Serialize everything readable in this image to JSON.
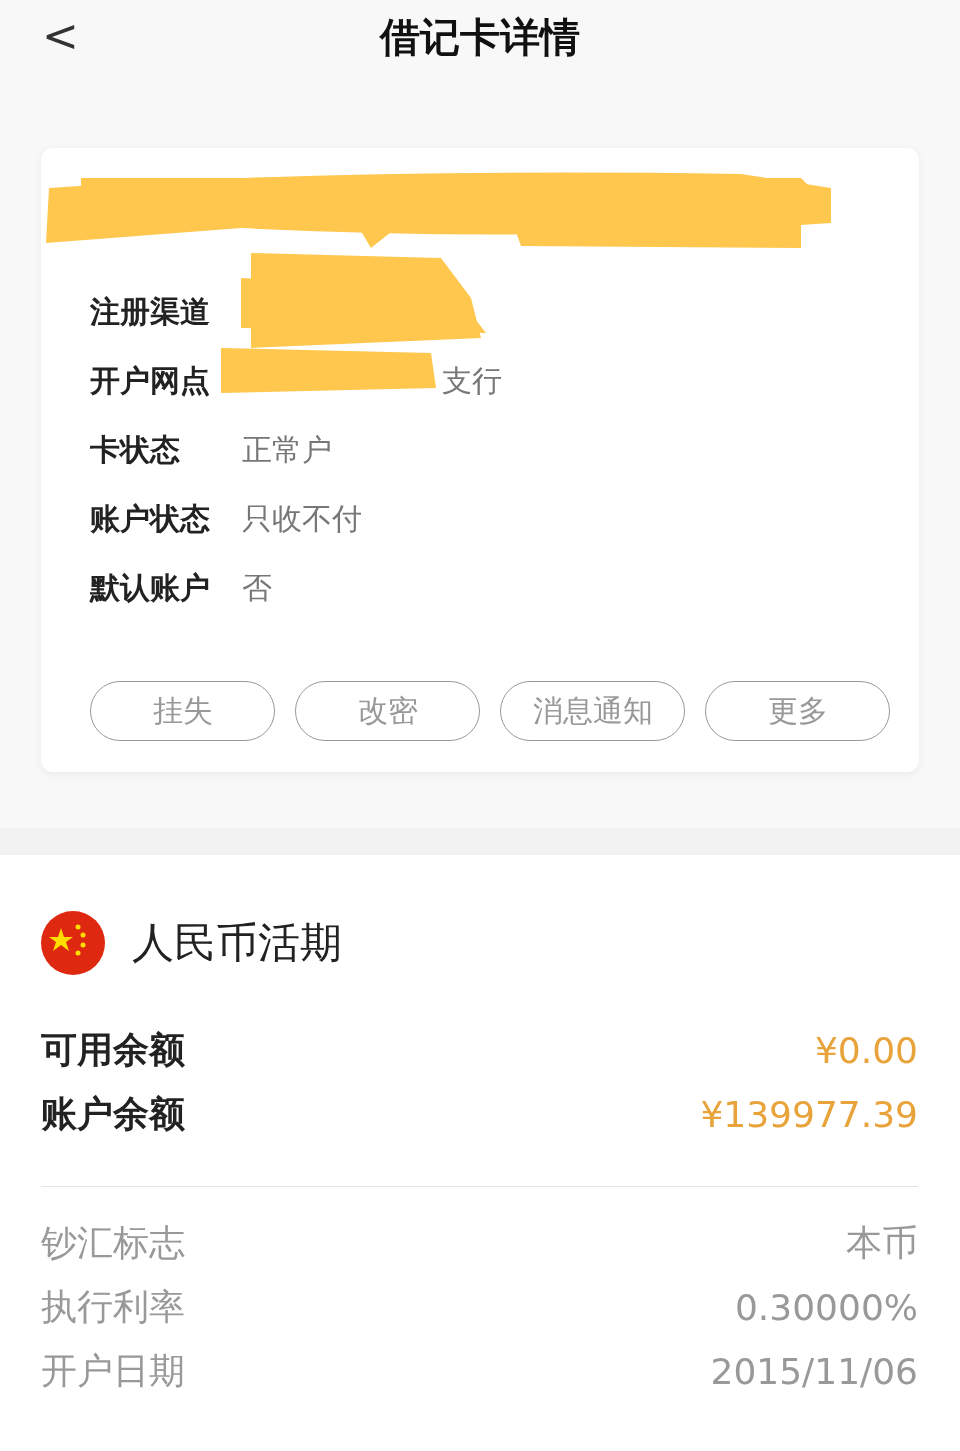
{
  "header": {
    "back": "<",
    "title": "借记卡详情"
  },
  "card": {
    "fields": [
      {
        "label": "注册渠道"
      },
      {
        "label": "开户网点",
        "value": "支行",
        "kind": "partly-hidden"
      },
      {
        "label": "卡状态",
        "value": "正常户"
      },
      {
        "label": "账户状态",
        "value": "只收不付"
      },
      {
        "label": "默认账户",
        "value": "否"
      }
    ],
    "actions": [
      "挂失",
      "改密",
      "消息通知",
      "更多"
    ]
  },
  "account": {
    "title": "人民币活期",
    "balances": [
      {
        "label": "可用余额",
        "amount": "¥0.00"
      },
      {
        "label": "账户余额",
        "amount": "¥139977.39"
      }
    ],
    "details": [
      {
        "label": "钞汇标志",
        "value": "本币"
      },
      {
        "label": "执行利率",
        "value": "0.30000%"
      },
      {
        "label": "开户日期",
        "value": "2015/11/06"
      }
    ]
  }
}
